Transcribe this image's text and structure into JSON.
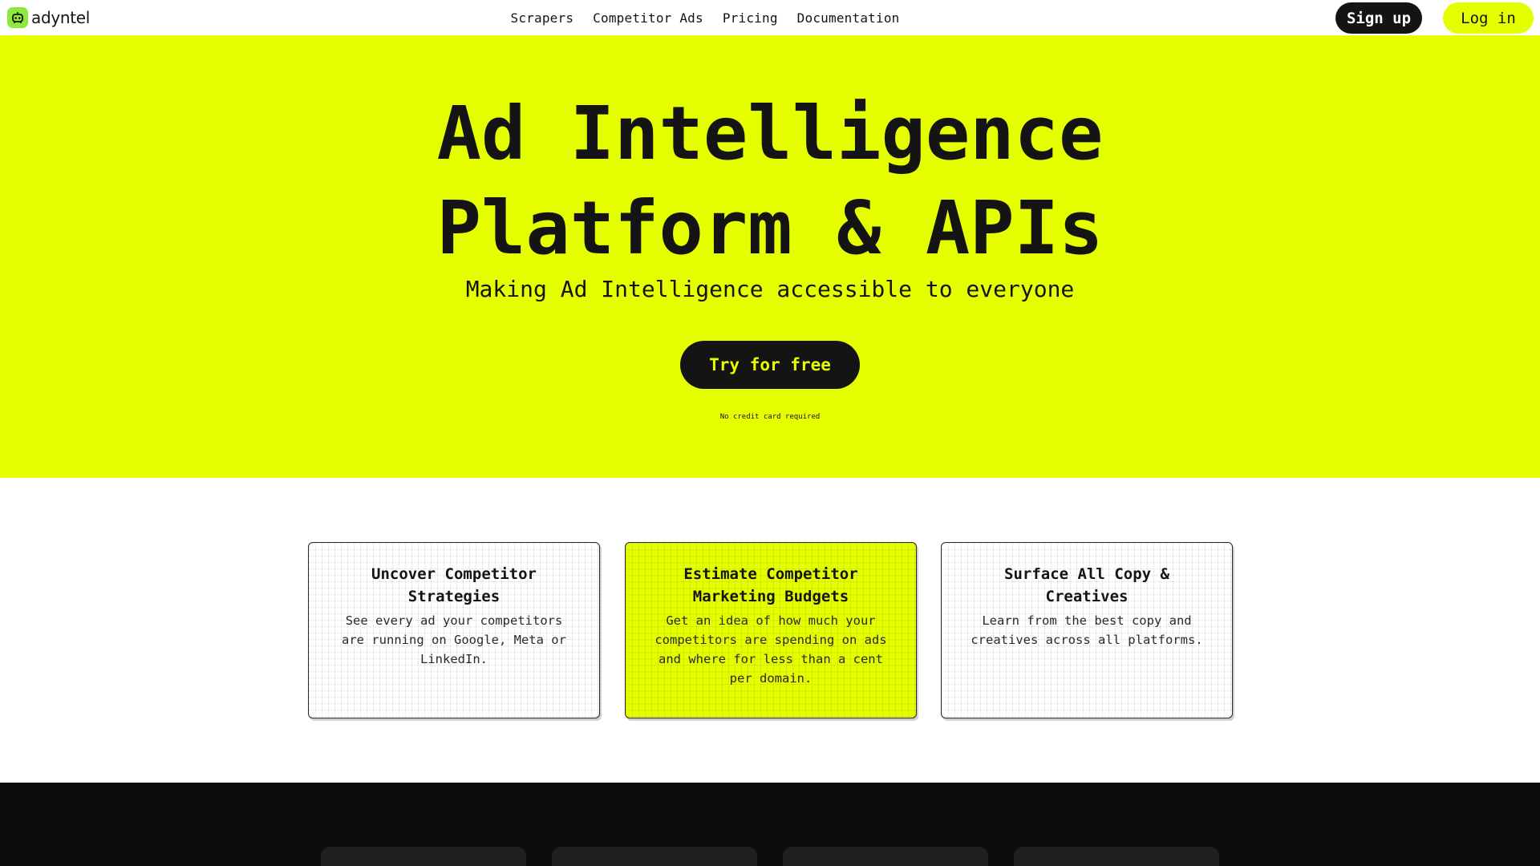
{
  "brand": {
    "name": "adyntel",
    "icon": "robot-icon",
    "accent": "#e5ff00",
    "dark": "#141414"
  },
  "nav": {
    "items": [
      {
        "label": "Scrapers"
      },
      {
        "label": "Competitor Ads"
      },
      {
        "label": "Pricing"
      },
      {
        "label": "Documentation"
      }
    ]
  },
  "auth": {
    "signup_label": "Sign up",
    "login_label": "Log in"
  },
  "hero": {
    "title_line1": "Ad Intelligence",
    "title_line2": "Platform & APIs",
    "subtitle": "Making Ad Intelligence accessible to everyone",
    "cta_label": "Try for free",
    "note": "No credit card required"
  },
  "features": [
    {
      "title": "Uncover Competitor Strategies",
      "desc": "See every ad your competitors are running on Google, Meta or LinkedIn."
    },
    {
      "title": "Estimate Competitor Marketing Budgets",
      "desc": "Get an idea of how much your competitors are spending on ads and where for less than a cent per domain."
    },
    {
      "title": "Surface All Copy & Creatives",
      "desc": "Learn from the best copy and creatives across all platforms."
    }
  ]
}
